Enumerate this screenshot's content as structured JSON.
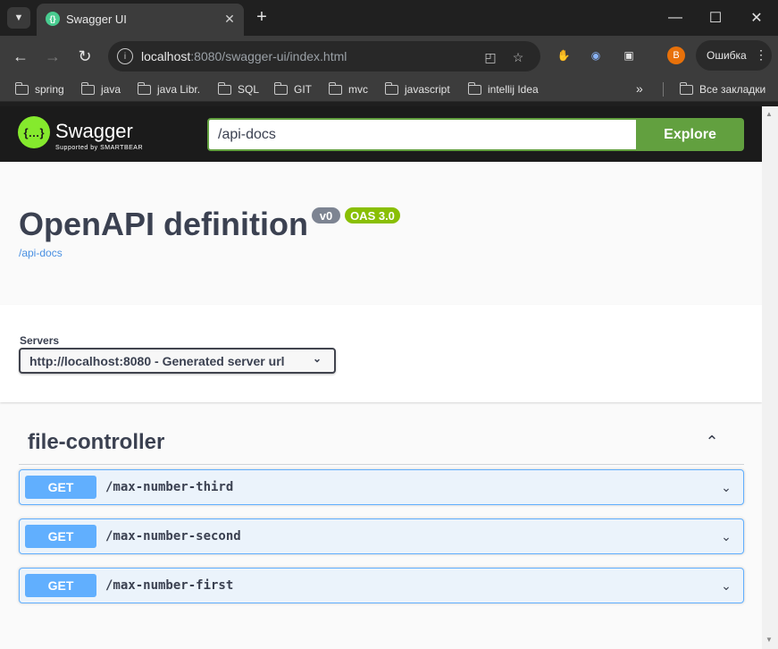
{
  "browser": {
    "tab_title": "Swagger UI",
    "url_host": "localhost",
    "url_rest": ":8080/swagger-ui/index.html",
    "profile_initial": "B",
    "error_label": "Ошибка",
    "bookmarks": [
      "spring",
      "java",
      "java Libr.",
      "SQL",
      "GIT",
      "mvc",
      "javascript",
      "intellij Idea"
    ],
    "all_bookmarks": "Все закладки"
  },
  "swagger": {
    "logo_text": "Swagger",
    "logo_sub": "Supported by SMARTBEAR",
    "url_value": "/api-docs",
    "explore_label": "Explore",
    "title": "OpenAPI definition",
    "version_badge": "v0",
    "oas_badge": "OAS 3.0",
    "spec_link": "/api-docs",
    "servers_label": "Servers",
    "server_selected": "http://localhost:8080 - Generated server url",
    "tag": "file-controller",
    "operations": [
      {
        "method": "GET",
        "path": "/max-number-third"
      },
      {
        "method": "GET",
        "path": "/max-number-second"
      },
      {
        "method": "GET",
        "path": "/max-number-first"
      }
    ]
  },
  "colors": {
    "get_blue": "#61affe",
    "swagger_green": "#62a03f",
    "oas_green": "#89bf04"
  }
}
